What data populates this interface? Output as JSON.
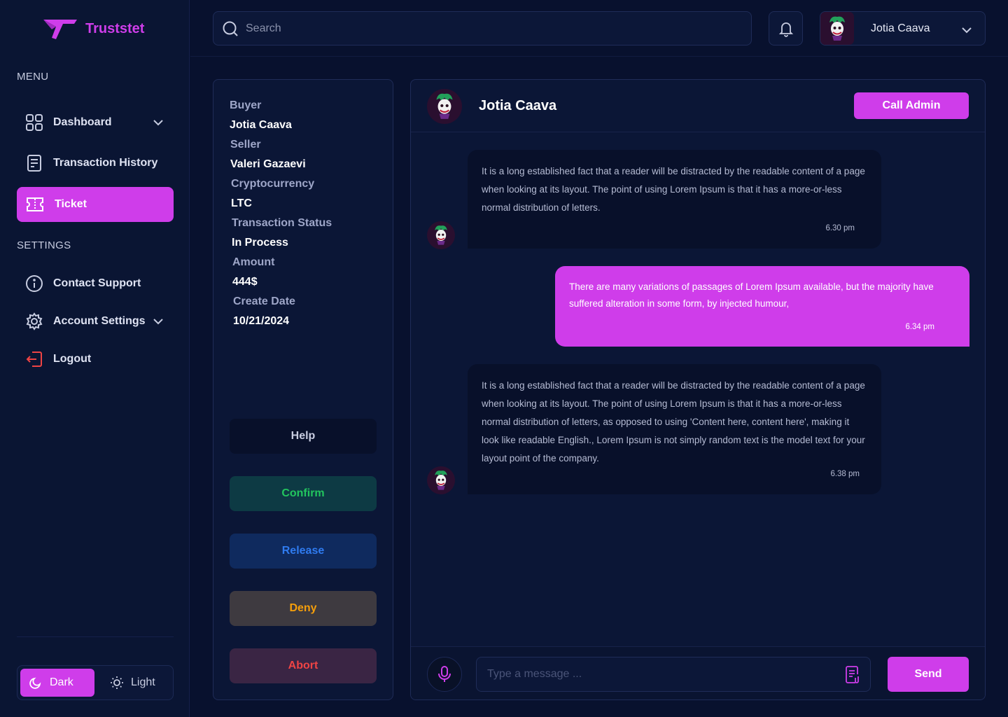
{
  "brand": {
    "name": "Truststet",
    "accent": "#cf3dea"
  },
  "sidebar": {
    "menu_label": "MENU",
    "settings_label": "SETTINGS",
    "items": [
      {
        "label": "Dashboard",
        "icon": "grid-icon",
        "has_dropdown": true,
        "active": false
      },
      {
        "label": "Transaction History",
        "icon": "document-icon",
        "has_dropdown": false,
        "active": false
      },
      {
        "label": "Ticket",
        "icon": "ticket-icon",
        "has_dropdown": false,
        "active": true
      }
    ],
    "settings_items": [
      {
        "label": "Contact Support",
        "icon": "info-icon"
      },
      {
        "label": "Account Settings",
        "icon": "gear-icon",
        "has_dropdown": true
      },
      {
        "label": "Logout",
        "icon": "logout-icon"
      }
    ],
    "theme": {
      "dark_label": "Dark",
      "light_label": "Light",
      "selected": "Dark"
    }
  },
  "header": {
    "search_placeholder": "Search",
    "user_name": "Jotia Caava"
  },
  "details": {
    "buyer_label": "Buyer",
    "buyer": "Jotia Caava",
    "seller_label": "Seller",
    "seller": "Valeri Gazaevi",
    "crypto_label": "Cryptocurrency",
    "crypto": "LTC",
    "status_label": "Transaction Status",
    "status": "In Process",
    "amount_label": "Amount",
    "amount": "444$",
    "date_label": "Create Date",
    "date": "10/21/2024",
    "actions": {
      "help": "Help",
      "confirm": "Confirm",
      "release": "Release",
      "deny": "Deny",
      "abort": "Abort"
    },
    "action_colors": {
      "help_bg": "#08102a",
      "help_fg": "#c7cce0",
      "confirm_bg": "#0d3a44",
      "confirm_fg": "#22c55e",
      "release_bg": "#0f2a5e",
      "release_fg": "#2f7bf0",
      "deny_bg": "#3e3a40",
      "deny_fg": "#f59e0b",
      "abort_bg": "#3a2544",
      "abort_fg": "#ef4444"
    }
  },
  "chat": {
    "contact_name": "Jotia Caava",
    "call_admin_label": "Call Admin",
    "messages": [
      {
        "direction": "in",
        "text": "It is a long established fact that a reader will be distracted by the readable content of a page when looking at its layout. The point of using Lorem Ipsum is that it has a more-or-less normal distribution of letters.",
        "time": "6.30 pm"
      },
      {
        "direction": "out",
        "text": "There are many variations of passages of Lorem Ipsum available, but the majority have suffered alteration in some form, by injected humour,",
        "time": "6.34 pm"
      },
      {
        "direction": "in",
        "text": "It is a long established fact that a reader will be distracted by the readable content of a page when looking at its layout. The point of using Lorem Ipsum is that it has a more-or-less normal distribution of letters, as opposed to using 'Content here, content here', making it look like readable English., Lorem Ipsum is not simply random text is the model text for your layout point of the company.",
        "time": "6.38 pm"
      }
    ],
    "composer_placeholder": "Type a message ...",
    "send_label": "Send"
  }
}
